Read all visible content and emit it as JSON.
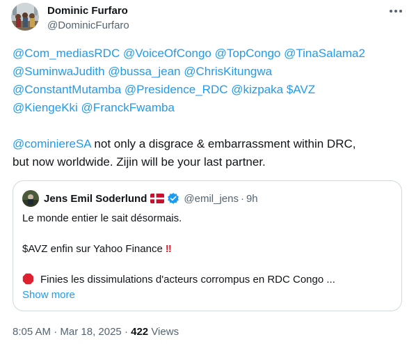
{
  "author": {
    "name": "Dominic Furfaro",
    "handle": "@DominicFurfaro"
  },
  "more_icon": "more-horizontal-icon",
  "tweet": {
    "lines": [
      [
        {
          "type": "mention",
          "text": "@Com_mediasRDC"
        },
        {
          "type": "text",
          "text": " "
        },
        {
          "type": "mention",
          "text": "@VoiceOfCongo"
        },
        {
          "type": "text",
          "text": " "
        },
        {
          "type": "mention",
          "text": "@TopCongo"
        },
        {
          "type": "text",
          "text": " "
        },
        {
          "type": "mention",
          "text": "@TinaSalama2"
        }
      ],
      [
        {
          "type": "mention",
          "text": "@SuminwaJudith"
        },
        {
          "type": "text",
          "text": " "
        },
        {
          "type": "mention",
          "text": "@bussa_jean"
        },
        {
          "type": "text",
          "text": " "
        },
        {
          "type": "mention",
          "text": "@ChrisKitungwa"
        }
      ],
      [
        {
          "type": "mention",
          "text": "@ConstantMutamba"
        },
        {
          "type": "text",
          "text": " "
        },
        {
          "type": "mention",
          "text": "@Presidence_RDC"
        },
        {
          "type": "text",
          "text": " "
        },
        {
          "type": "mention",
          "text": "@kizpaka"
        },
        {
          "type": "text",
          "text": " "
        },
        {
          "type": "cashtag",
          "text": "$AVZ"
        }
      ],
      [
        {
          "type": "mention",
          "text": "@KiengeKki"
        },
        {
          "type": "text",
          "text": " "
        },
        {
          "type": "mention",
          "text": "@FranckFwamba"
        }
      ],
      [],
      [
        {
          "type": "mention",
          "text": "@cominiereSA"
        },
        {
          "type": "text",
          "text": " not only a disgrace & embarrassment within DRC,"
        }
      ],
      [
        {
          "type": "text",
          "text": "but now worldwide. Zijin will be your last partner."
        }
      ]
    ]
  },
  "quote": {
    "name": "Jens Emil Soderlund",
    "flag_icon": "denmark-flag-icon",
    "verified_icon": "verified-badge-icon",
    "handle": "@emil_jens",
    "separator": "·",
    "time": "9h",
    "line1": "Le monde entier le sait désormais.",
    "line2": "$AVZ enfin sur Yahoo Finance",
    "line2_emoji": "‼",
    "line3": "Finies les dissimulations d'acteurs corrompus en RDC Congo ...",
    "line3_icon": "stop-sign-icon",
    "show_more": "Show more"
  },
  "meta": {
    "time": "8:05 AM",
    "sep1": " · ",
    "date": "Mar 18, 2025",
    "sep2": " · ",
    "views_count": "422",
    "views_label": " Views"
  },
  "colors": {
    "link": "#1d9bf0",
    "secondary": "#536471",
    "border": "#cfd9de",
    "text": "#0f1419"
  }
}
